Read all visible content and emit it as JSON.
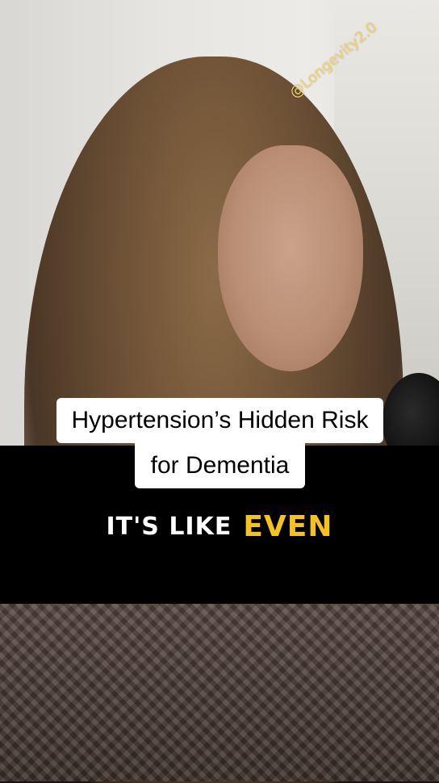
{
  "watermark": {
    "text": "@Longevity2.0"
  },
  "title": {
    "line1": "Hypertension’s Hidden Risk",
    "line2": "for Dementia"
  },
  "caption": {
    "white_part": "IT'S LIKE",
    "highlight_part": "EVEN",
    "highlight_color": "#F5C31A"
  },
  "colors": {
    "title_background": "#FFFFFF",
    "caption_band": "#000000"
  }
}
